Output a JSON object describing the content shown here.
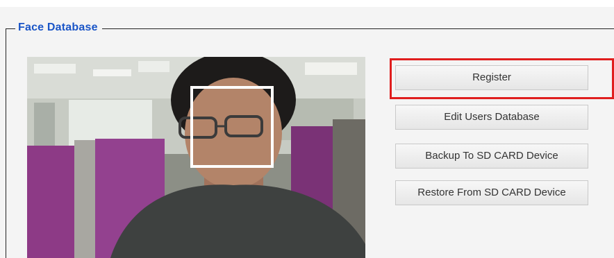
{
  "panel": {
    "legend": "Face Database"
  },
  "camera": {
    "description_icon": "camera-preview"
  },
  "buttons": {
    "register": "Register",
    "edit_users": "Edit Users Database",
    "backup": "Backup To SD CARD Device",
    "restore": "Restore From SD CARD Device"
  },
  "colors": {
    "legend_text": "#1a55c7",
    "highlight_border": "#e01e1e",
    "button_text": "#333333"
  }
}
